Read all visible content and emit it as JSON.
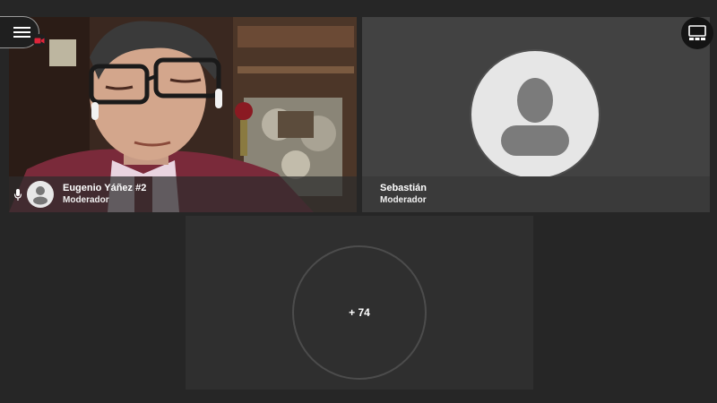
{
  "participants": [
    {
      "name": "Eugenio Yáñez #2",
      "role": "Moderador",
      "video": true,
      "mic_icon": "microphone-icon",
      "avatar_icon": "user-icon"
    },
    {
      "name": "Sebastián",
      "role": "Moderador",
      "video": false,
      "avatar_icon": "user-icon"
    }
  ],
  "overflow": {
    "label": "+ 74"
  },
  "controls": {
    "menu_icon": "hamburger-icon",
    "recording_icon": "recording-camera-icon",
    "layout_icon": "layout-icon"
  },
  "colors": {
    "background": "#262626",
    "tile_empty": "#424242",
    "tile_more": "#2f2f2f",
    "recording": "#e0243a",
    "text": "#ffffff"
  }
}
